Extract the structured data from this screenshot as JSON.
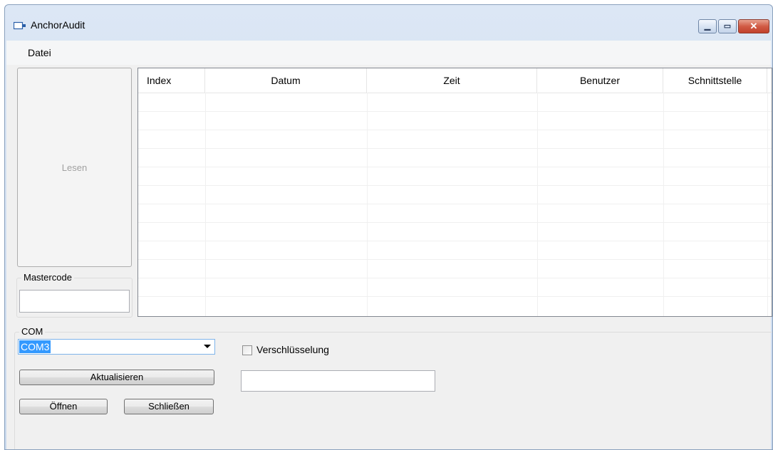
{
  "window": {
    "title": "AnchorAudit",
    "icon": "app-window-icon"
  },
  "titlebar_buttons": {
    "minimize": "minimize-icon",
    "maximize": "maximize-icon",
    "close": "close-icon"
  },
  "menu": {
    "items": [
      "Datei"
    ]
  },
  "left_panel": {
    "read_button": "Lesen"
  },
  "mastercode": {
    "label": "Mastercode",
    "value": ""
  },
  "table": {
    "columns": [
      "Index",
      "Datum",
      "Zeit",
      "Benutzer",
      "Schnittstelle"
    ],
    "rows": []
  },
  "com": {
    "label": "COM",
    "port_selected": "COM3",
    "refresh_button": "Aktualisieren",
    "open_button": "Öffnen",
    "close_button": "Schließen",
    "encryption_label": "Verschlüsselung",
    "encryption_checked": false,
    "encryption_key_value": ""
  },
  "colors": {
    "selection": "#3399ff",
    "frame": "#c9d9ee",
    "close_button": "#c1412c"
  }
}
